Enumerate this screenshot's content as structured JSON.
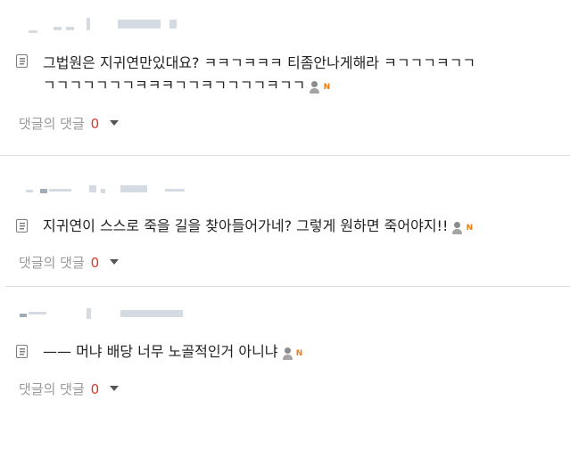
{
  "comments": [
    {
      "text_lines": [
        "그법원은 지귀연만있대요? ㅋㅋㄱㅋㅋㅋ 티좀안나게해라 ㅋㄱㄱㄱㅋㄱㄱ",
        "ㄱㄱㄱㄱㄱㄱㄱㅋㅋㅋㄱㄱㅋㄱㄱㄱㄱㅋㄱㄱ"
      ],
      "reply_label": "댓글의 댓글",
      "reply_count": "0",
      "badge_icons": [
        "user-icon",
        "new-icon"
      ],
      "new_badge": "N"
    },
    {
      "text_lines": [
        "지귀연이 스스로 죽을 길을 찾아들어가네? 그렇게 원하면 죽어야지!!"
      ],
      "reply_label": "댓글의 댓글",
      "reply_count": "0",
      "badge_icons": [
        "user-icon",
        "new-icon"
      ],
      "new_badge": "N"
    },
    {
      "text_lines": [
        "—— 머냐 배당 너무 노골적인거 아니냐"
      ],
      "reply_label": "댓글의 댓글",
      "reply_count": "0",
      "badge_icons": [
        "user-icon",
        "new-icon"
      ],
      "new_badge": "N"
    }
  ],
  "colors": {
    "text": "#222222",
    "muted": "#9a9a9a",
    "reply_count": "#d63a2a",
    "new_badge": "#f07c12",
    "divider": "#dcdcdc"
  }
}
